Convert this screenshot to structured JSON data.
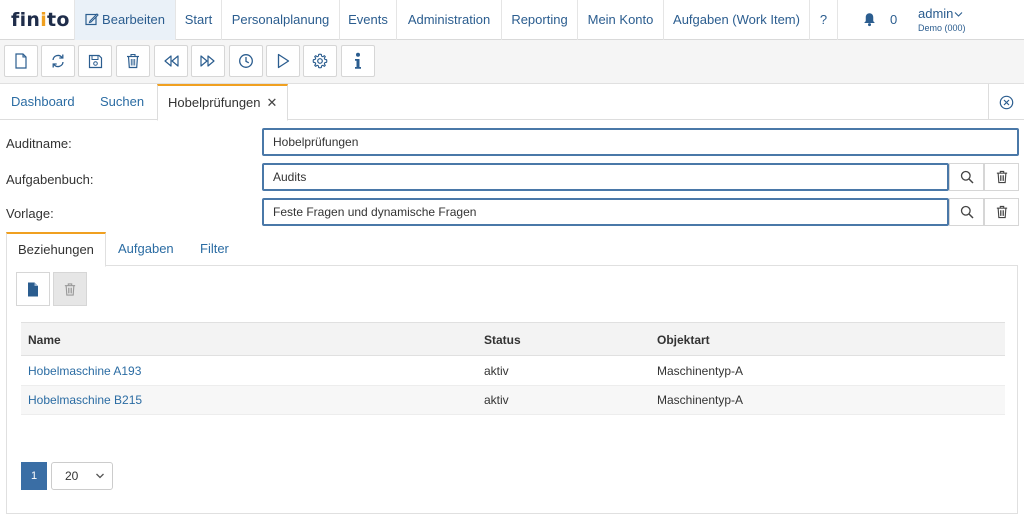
{
  "app": {
    "logo_left": "fin",
    "logo_dot": "i",
    "logo_right": "to"
  },
  "nav": {
    "items": [
      {
        "label": "Bearbeiten"
      },
      {
        "label": "Start"
      },
      {
        "label": "Personalplanung"
      },
      {
        "label": "Events"
      },
      {
        "label": "Administration"
      },
      {
        "label": "Reporting"
      },
      {
        "label": "Mein Konto"
      },
      {
        "label": "Aufgaben (Work Item)"
      },
      {
        "label": "?"
      }
    ],
    "notification_count": "0",
    "user_name": "admin",
    "user_sub": "Demo (000)"
  },
  "toolbar": {
    "icons": [
      "new-document-icon",
      "refresh-icon",
      "save-icon",
      "delete-icon",
      "rewind-icon",
      "fast-forward-icon",
      "clock-icon",
      "play-icon",
      "settings-icon",
      "info-icon"
    ]
  },
  "tabs": [
    {
      "label": "Dashboard"
    },
    {
      "label": "Suchen"
    },
    {
      "label": "Hobelprüfungen",
      "close": "✕"
    }
  ],
  "form": {
    "auditname_label": "Auditname:",
    "auditname_value": "Hobelprüfungen",
    "aufgabenbuch_label": "Aufgabenbuch:",
    "aufgabenbuch_value": "Audits",
    "vorlage_label": "Vorlage:",
    "vorlage_value": "Feste Fragen und dynamische Fragen"
  },
  "subtabs": [
    {
      "label": "Beziehungen"
    },
    {
      "label": "Aufgaben"
    },
    {
      "label": "Filter"
    }
  ],
  "table": {
    "headers": {
      "name": "Name",
      "status": "Status",
      "objektart": "Objektart"
    },
    "rows": [
      {
        "name": "Hobelmaschine A193",
        "status": "aktiv",
        "objektart": "Maschinentyp-A"
      },
      {
        "name": "Hobelmaschine B215",
        "status": "aktiv",
        "objektart": "Maschinentyp-A"
      }
    ]
  },
  "pagination": {
    "current_page": "1",
    "page_size": "20"
  },
  "colors": {
    "accent": "#f0a020",
    "link": "#2b6ca3",
    "primary": "#3a6ea5",
    "field_border": "#4a78a8"
  }
}
